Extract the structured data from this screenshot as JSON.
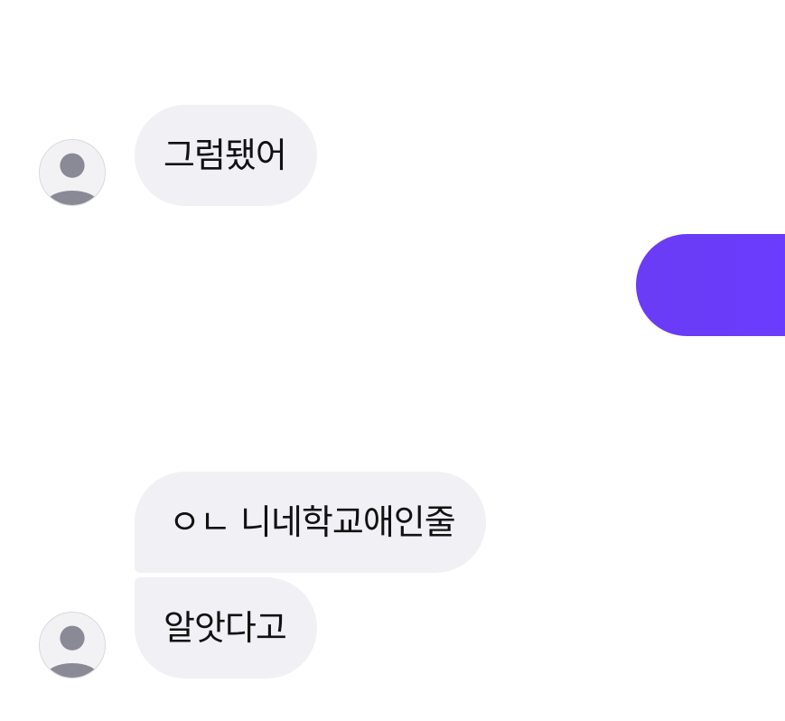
{
  "messages": [
    {
      "sender": "other",
      "text": "그럼됐어"
    },
    {
      "sender": "me",
      "text": ""
    },
    {
      "sender": "other",
      "text": "ㅇㄴ 니네학교애인줄"
    },
    {
      "sender": "other",
      "text": "알앗다고"
    }
  ],
  "avatar_icon": "default-user-avatar-icon",
  "colors": {
    "incoming_bubble": "#f0f0f5",
    "outgoing_bubble": "#6b3cff",
    "avatar_figure": "#8a8a96"
  }
}
